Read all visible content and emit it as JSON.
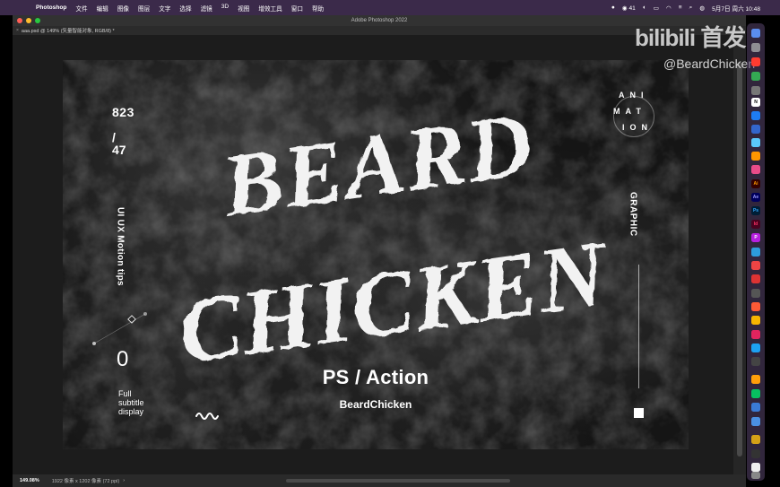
{
  "menubar": {
    "app_name": "Photoshop",
    "menus": [
      "文件",
      "编辑",
      "图像",
      "图层",
      "文字",
      "选择",
      "滤镜",
      "3D",
      "视图",
      "增效工具",
      "窗口",
      "帮助"
    ],
    "wechat_count": "41",
    "datetime": "5月7日 周六 10:48"
  },
  "window": {
    "title": "Adobe Photoshop 2022",
    "doc_tab": "aaa.psd @ 149% (矢量智能对象, RGB/8) *"
  },
  "statusbar": {
    "zoom": "149.08%",
    "info": "1922 像素 x 1202 像素 (72 ppi)"
  },
  "artwork": {
    "counter_top": "823",
    "counter_slash": "/",
    "counter_bottom": "47",
    "vertical_left": "UI UX Motion tips",
    "zero": "0",
    "subtitle_line1": "Full",
    "subtitle_line2": "subtitle",
    "subtitle_line3": "display",
    "title_line1": "BEARD",
    "title_line2": "CHICKEN",
    "ps_action": "PS / Action",
    "brand": "BeardChicken",
    "anim_row1": "ANI",
    "anim_row2": "MAT",
    "anim_row3": "ION",
    "vertical_right": "GRAPHIC"
  },
  "watermark": {
    "logo_text": "bilibili 首发",
    "handle": "@BeardChicken"
  },
  "colors": {
    "menubar": "#3b2a4a",
    "workspace": "#1c1c1c",
    "canvas": "#151515",
    "close": "#ff5f57",
    "minimize": "#febc2e",
    "zoom": "#28c840"
  }
}
